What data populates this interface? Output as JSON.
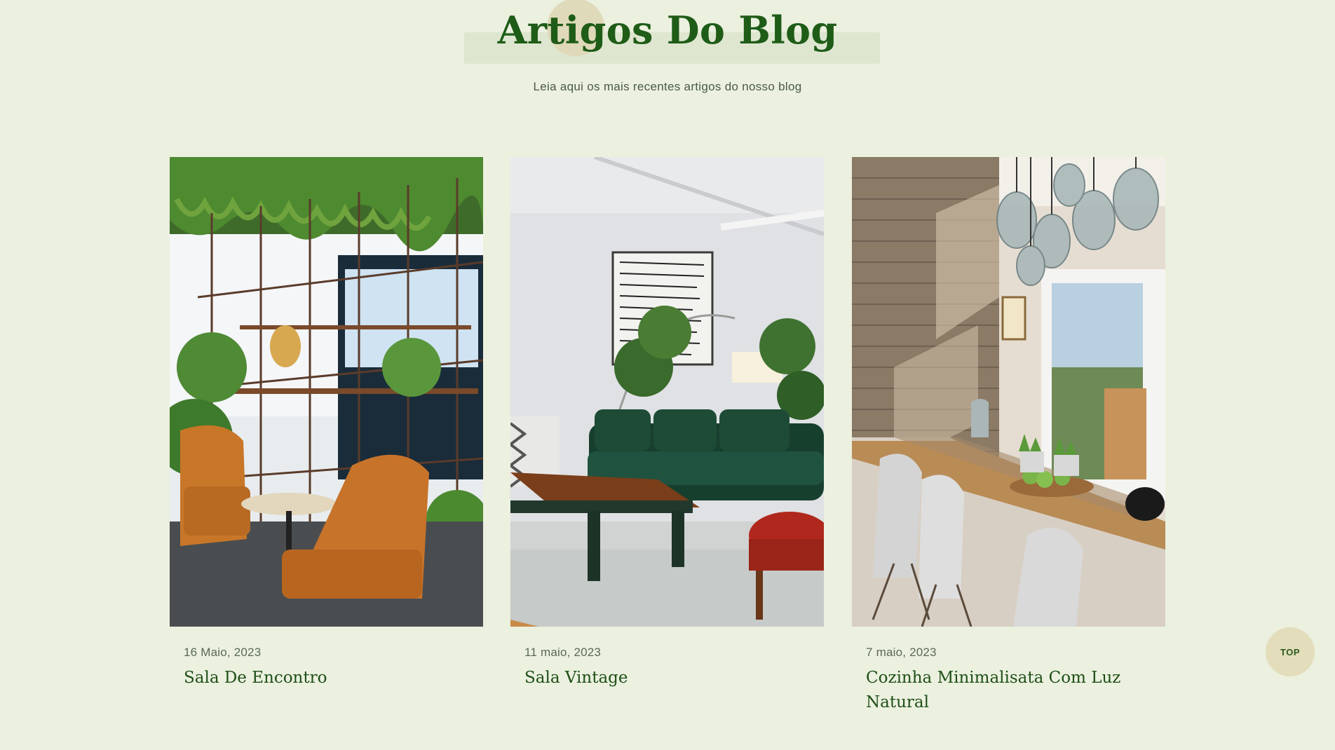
{
  "header": {
    "title": "Artigos Do Blog",
    "subtitle": "Leia aqui os mais recentes artigos do nosso blog"
  },
  "posts": [
    {
      "date": "16 Maio, 2023",
      "title": "Sala De Encontro",
      "image": "cafe-interior-with-orange-leather-chairs-and-hanging-plants"
    },
    {
      "date": "11 maio, 2023",
      "title": "Sala Vintage",
      "image": "living-room-with-green-velvet-sofa-and-wooden-coffee-table"
    },
    {
      "date": "7 maio, 2023",
      "title": "Cozinha Minimalisata Com Luz Natural",
      "image": "dining-room-with-brick-wall-glass-pendants-and-white-chairs"
    }
  ],
  "top_button": {
    "label": "TOP"
  },
  "colors": {
    "background": "#ebf0df",
    "heading": "#1e5c17",
    "accent_circle": "#ded8b7"
  }
}
